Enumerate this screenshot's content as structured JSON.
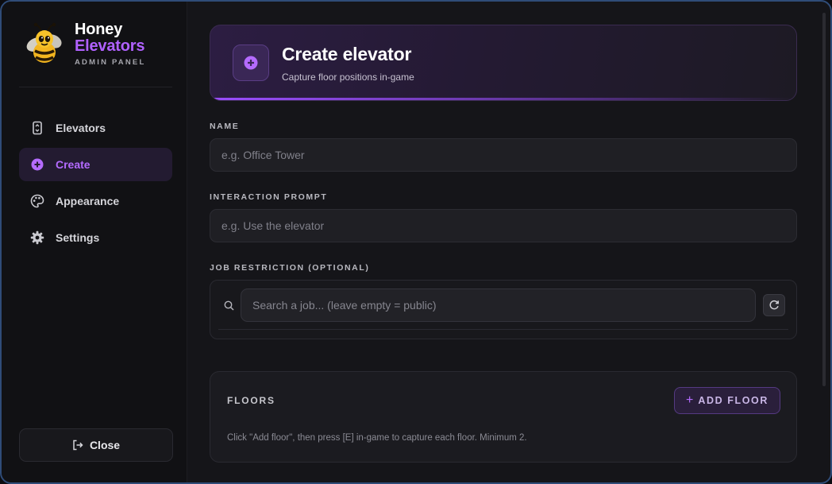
{
  "brand": {
    "title_line1": "Honey",
    "title_line2": "Elevators",
    "subtitle": "ADMIN PANEL"
  },
  "sidebar": {
    "items": [
      {
        "label": "Elevators",
        "icon": "elevator-icon",
        "active": false
      },
      {
        "label": "Create",
        "icon": "plus-circle-icon",
        "active": true
      },
      {
        "label": "Appearance",
        "icon": "palette-icon",
        "active": false
      },
      {
        "label": "Settings",
        "icon": "gear-icon",
        "active": false
      }
    ],
    "close_label": "Close"
  },
  "header": {
    "title": "Create elevator",
    "subtitle": "Capture floor positions in-game"
  },
  "form": {
    "name": {
      "label": "NAME",
      "placeholder": "e.g. Office Tower",
      "value": ""
    },
    "prompt": {
      "label": "INTERACTION PROMPT",
      "placeholder": "e.g. Use the elevator",
      "value": ""
    },
    "job": {
      "label": "JOB RESTRICTION (OPTIONAL)",
      "placeholder": "Search a job... (leave empty = public)",
      "value": ""
    }
  },
  "floors": {
    "title": "FLOORS",
    "add_label": "ADD FLOOR",
    "hint": "Click \"Add floor\", then press [E] in-game to capture each floor. Minimum 2."
  },
  "colors": {
    "accent": "#b061ff",
    "window_border": "#2f4c78",
    "background": "#151519"
  }
}
